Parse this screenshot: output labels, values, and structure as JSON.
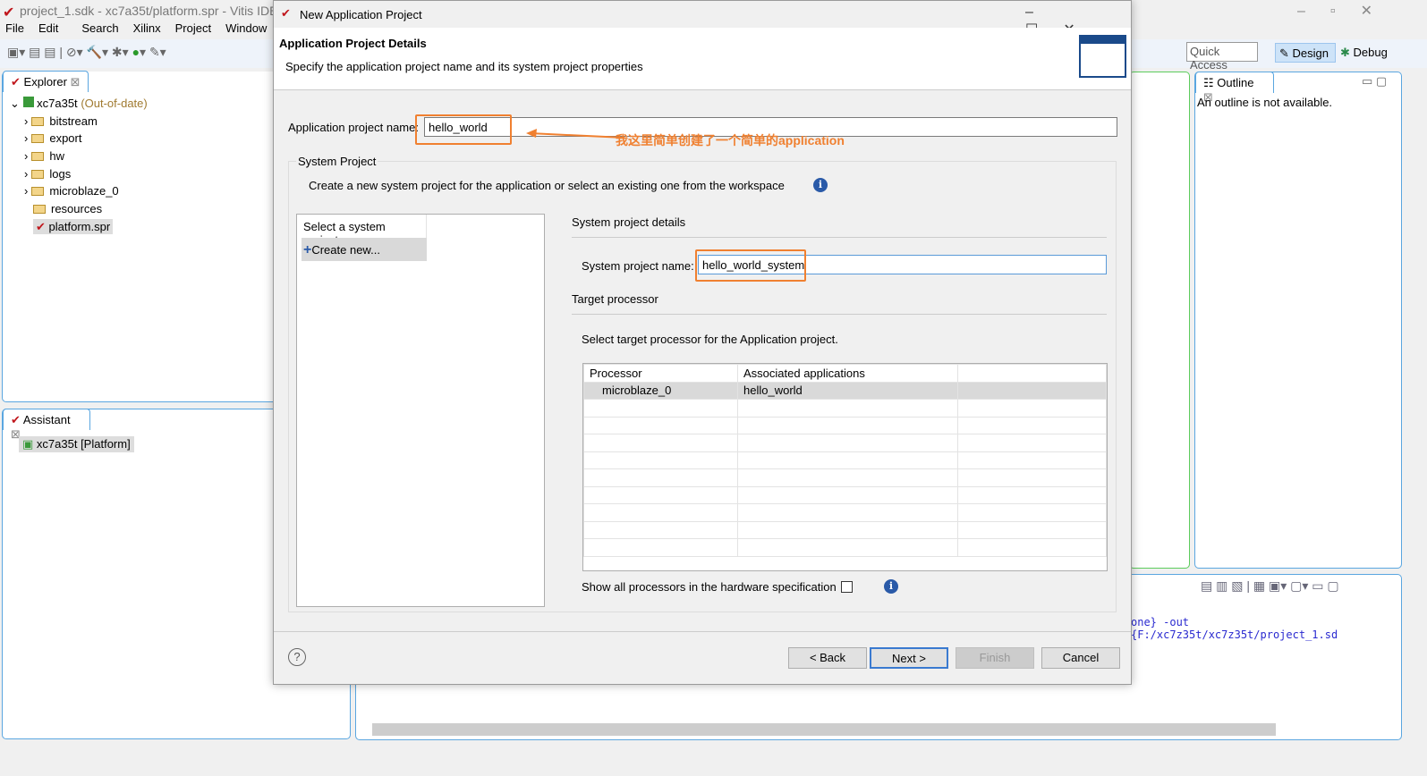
{
  "ide": {
    "title": "project_1.sdk - xc7a35t/platform.spr - Vitis IDE",
    "menu": [
      "File",
      "Edit",
      "Search",
      "Xilinx",
      "Project",
      "Window",
      "He"
    ],
    "quick_access": "Quick Access",
    "perspectives": [
      "Design",
      "Debug"
    ]
  },
  "explorer": {
    "tab": "Explorer",
    "root": "xc7a35t",
    "root_status": "(Out-of-date)",
    "items": [
      "bitstream",
      "export",
      "hw",
      "logs",
      "microblaze_0",
      "resources",
      "platform.spr"
    ]
  },
  "assistant": {
    "tab": "Assistant",
    "item": "xc7a35t [Platform]"
  },
  "outline": {
    "tab": "Outline",
    "message": "An outline is not available."
  },
  "console": {
    "line": "one} -out {F:/xc7z35t/xc7z35t/project_1.sd"
  },
  "dialog": {
    "title": "New Application Project",
    "heading": "Application Project Details",
    "subheading": "Specify the application project name and its system project properties",
    "app_name_label": "Application project name:",
    "app_name_value": "hello_world",
    "annotation": "我这里简单创建了一个简单的application",
    "annotation_color": "#f08030",
    "system_group": "System Project",
    "system_desc": "Create a new system project for the application or select an existing one from the workspace",
    "select_header": "Select a system project",
    "create_new": "Create new...",
    "details_header": "System project details",
    "sys_name_label": "System project name:",
    "sys_name_value": "hello_world_system",
    "target_header": "Target processor",
    "target_desc": "Select target processor for the Application project.",
    "columns": [
      "Processor",
      "Associated applications",
      ""
    ],
    "rows": [
      [
        "microblaze_0",
        "hello_world",
        ""
      ]
    ],
    "show_all_label": "Show all processors in the hardware specification",
    "show_all_checked": false,
    "buttons": {
      "back": "< Back",
      "next": "Next >",
      "finish": "Finish",
      "cancel": "Cancel"
    }
  }
}
